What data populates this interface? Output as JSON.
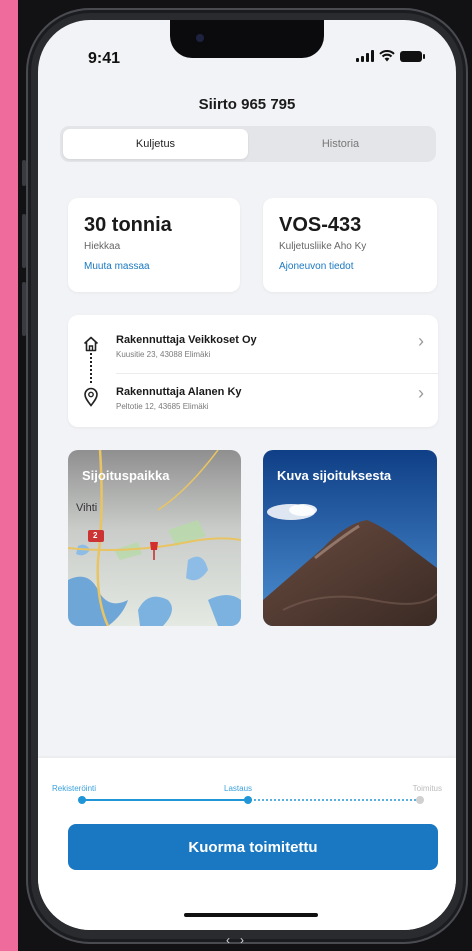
{
  "status": {
    "time": "9:41"
  },
  "header": {
    "title": "Siirto 965 795"
  },
  "tabs": [
    {
      "label": "Kuljetus",
      "active": true
    },
    {
      "label": "Historia",
      "active": false
    }
  ],
  "load": {
    "amount": "30 tonnia",
    "material": "Hiekkaa",
    "link": "Muuta massaa"
  },
  "vehicle": {
    "plate": "VOS-433",
    "company": "Kuljetusliike Aho Ky",
    "link": "Ajoneuvon tiedot"
  },
  "route": [
    {
      "name": "Rakennuttaja Veikkoset Oy",
      "address": "Kuusitie 23, 43088 Elimäki",
      "icon": "home-icon"
    },
    {
      "name": "Rakennuttaja Alanen Ky",
      "address": "Peltotie 12, 43685 Elimäki",
      "icon": "location-pin-icon"
    }
  ],
  "map_card": {
    "label": "Sijoituspaikka",
    "place": "Vihti",
    "road": "2"
  },
  "photo_card": {
    "label": "Kuva sijoituksesta"
  },
  "progress": {
    "steps": [
      "Rekisteröinti",
      "Lastaus",
      "Toimitus"
    ],
    "current_step": 2
  },
  "cta": {
    "label": "Kuorma toimitettu"
  },
  "colors": {
    "accent": "#1a78c2",
    "background": "#f2f3f6",
    "frame": "#ee6b9b"
  }
}
